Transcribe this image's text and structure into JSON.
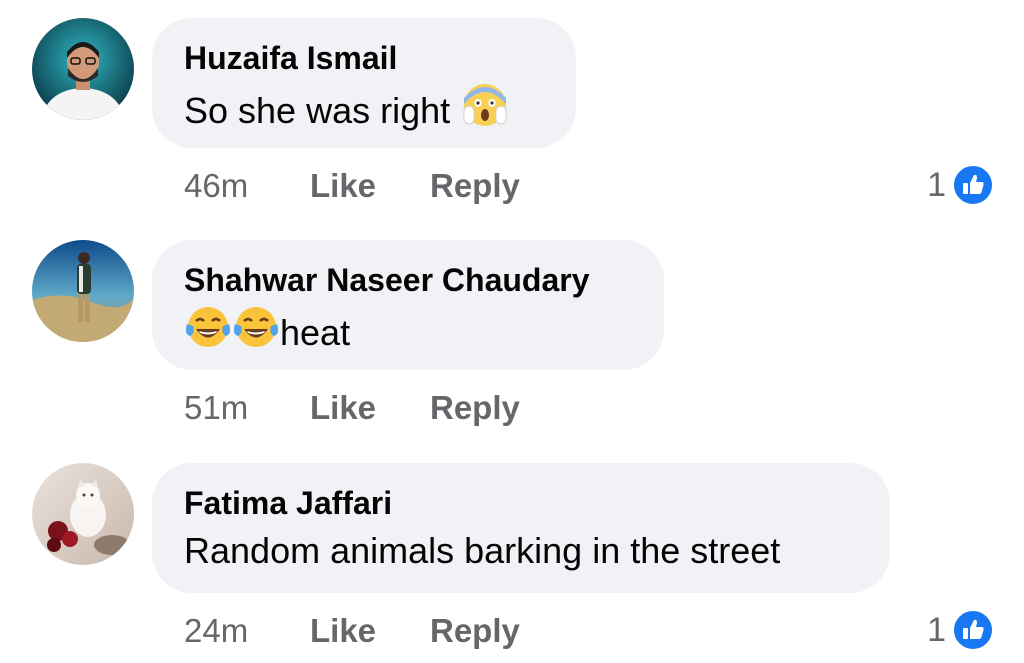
{
  "comments": [
    {
      "author": "Huzaifa Ismail",
      "text": "So she was right",
      "emoji_after": [
        "face-screaming-in-fear"
      ],
      "time": "46m",
      "like_label": "Like",
      "reply_label": "Reply",
      "reaction_count": "1"
    },
    {
      "author": "Shahwar Naseer Chaudary",
      "text": "heat",
      "emoji_before": [
        "face-with-tears-of-joy",
        "face-with-tears-of-joy"
      ],
      "time": "51m",
      "like_label": "Like",
      "reply_label": "Reply"
    },
    {
      "author": "Fatima Jaffari",
      "text": "Random animals barking in the street",
      "time": "24m",
      "like_label": "Like",
      "reply_label": "Reply",
      "reaction_count": "1"
    }
  ],
  "colors": {
    "bubble": "#f0f2f5",
    "meta_text": "#65676b",
    "like_blue": "#1877f2"
  }
}
